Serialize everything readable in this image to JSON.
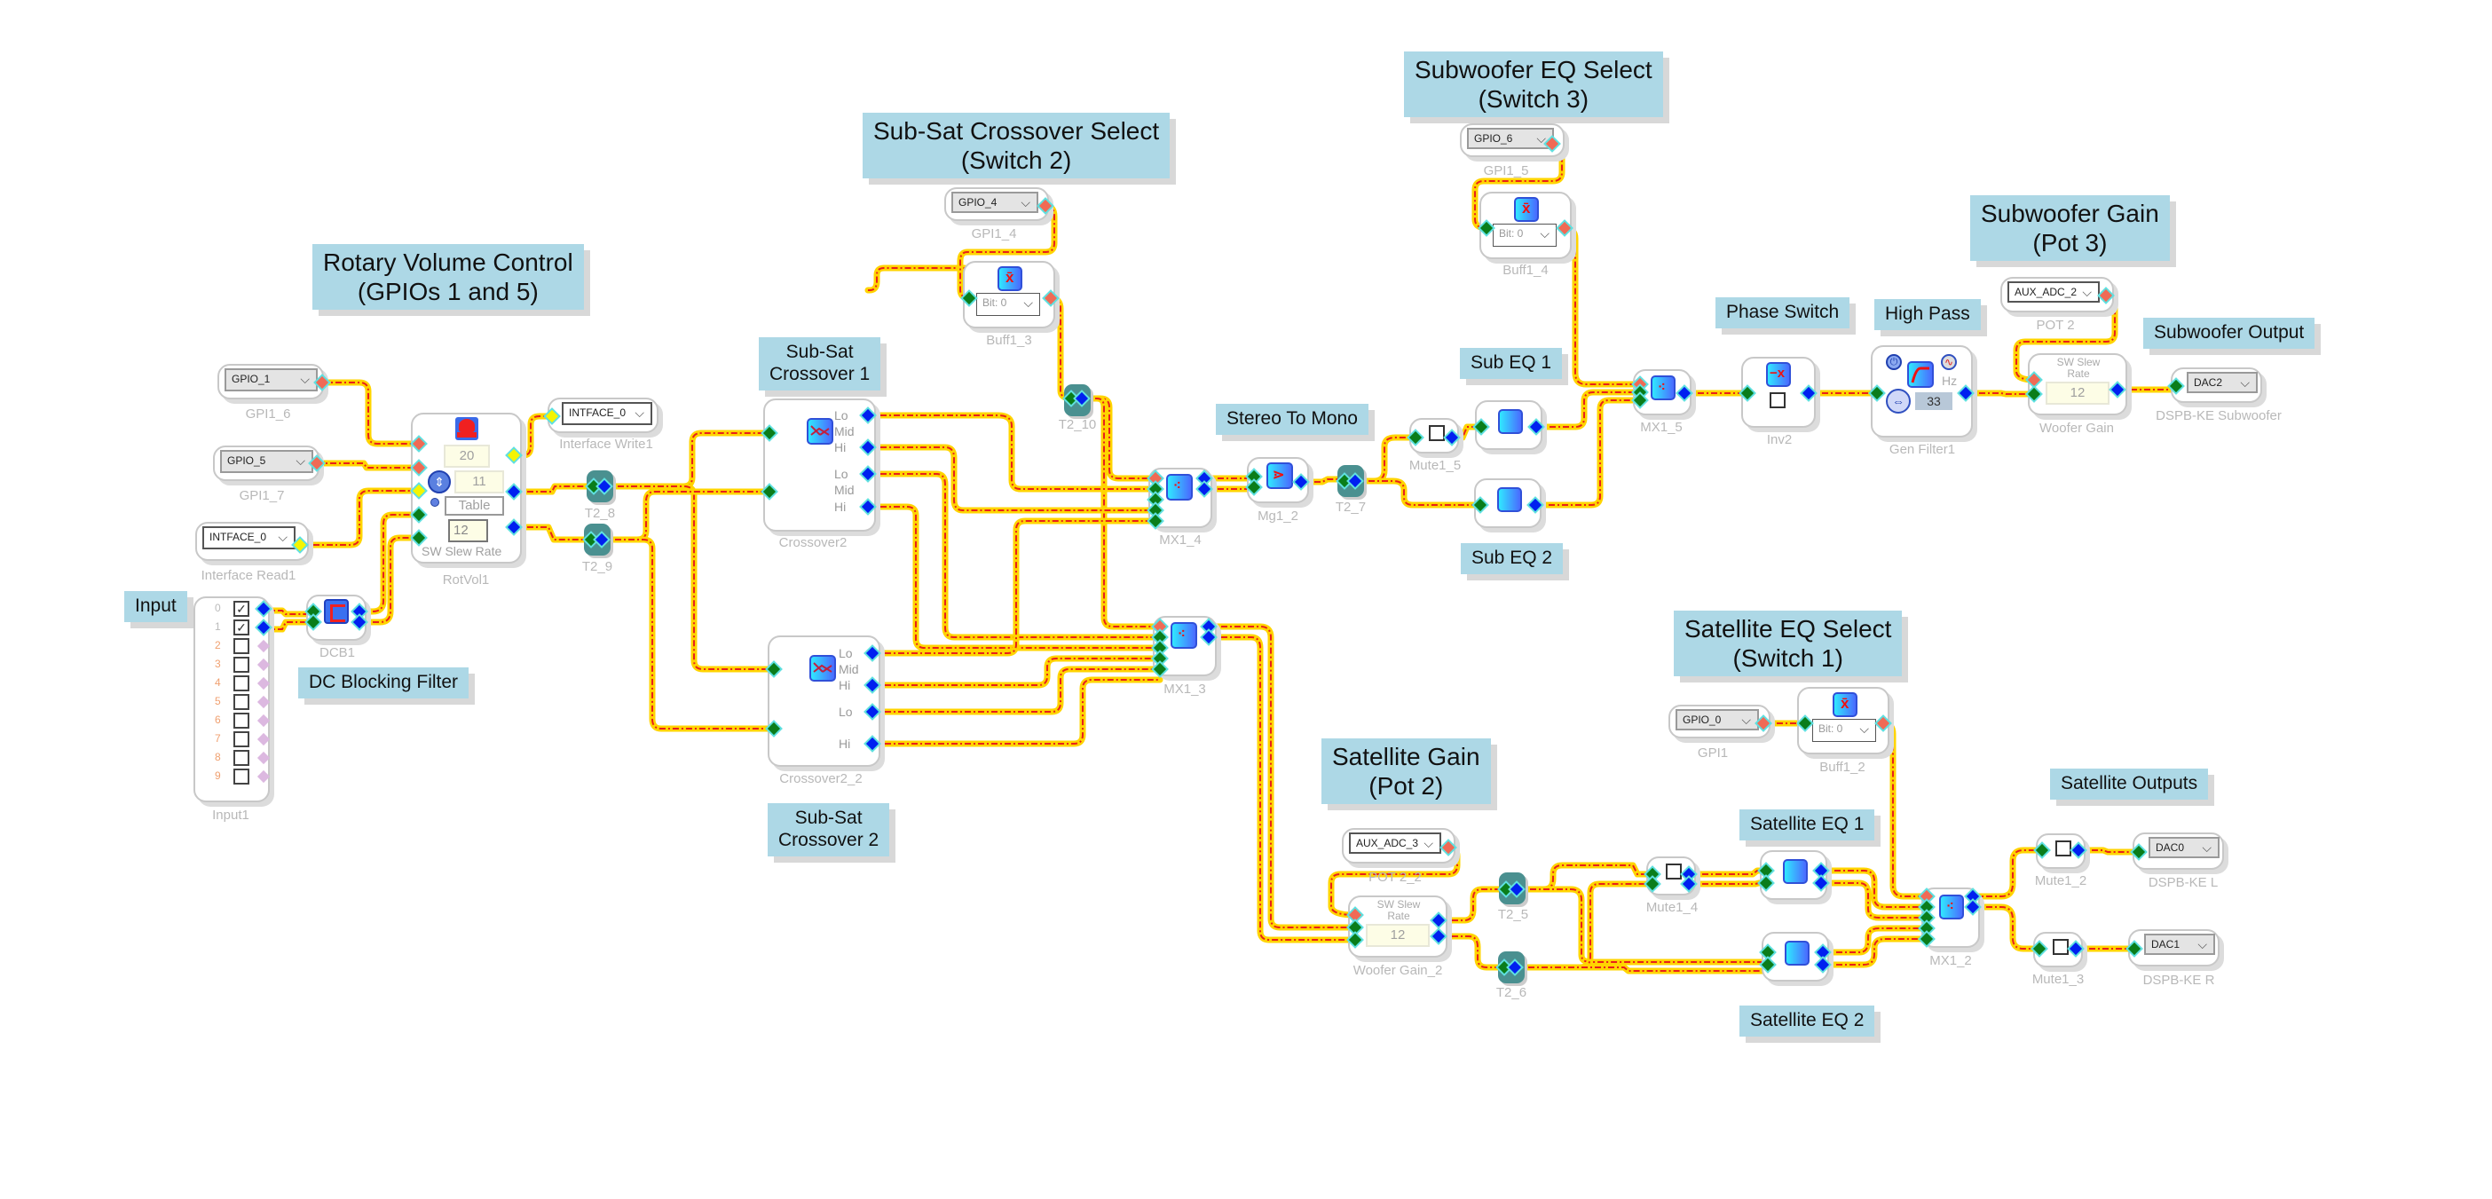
{
  "notes": {
    "rotary_volume": "Rotary Volume Control\n(GPIOs 1 and 5)",
    "input": "Input",
    "dc_blocking": "DC Blocking Filter",
    "subsat_crossover1": "Sub-Sat\nCrossover 1",
    "subsat_crossover2": "Sub-Sat\nCrossover 2",
    "subsat_select": "Sub-Sat Crossover Select\n(Switch 2)",
    "stereo_to_mono": "Stereo To Mono",
    "sub_eq1": "Sub EQ 1",
    "sub_eq2": "Sub EQ 2",
    "subwoofer_eq_select": "Subwoofer EQ Select\n(Switch 3)",
    "phase_switch": "Phase Switch",
    "high_pass": "High Pass",
    "subwoofer_gain": "Subwoofer Gain\n(Pot 3)",
    "subwoofer_output": "Subwoofer Output",
    "satellite_eq_select": "Satellite EQ Select\n(Switch 1)",
    "satellite_gain": "Satellite Gain\n(Pot 2)",
    "satellite_eq1": "Satellite EQ 1",
    "satellite_eq2": "Satellite EQ 2",
    "satellite_outputs": "Satellite Outputs"
  },
  "blocks": {
    "gpi1_6": {
      "label": "GPI1_6",
      "value": "GPIO_1"
    },
    "gpi1_7": {
      "label": "GPI1_7",
      "value": "GPIO_5"
    },
    "interface_read1": {
      "label": "Interface Read1",
      "value": "INTFACE_0"
    },
    "interface_write1": {
      "label": "Interface Write1",
      "value": "INTFACE_0"
    },
    "rotvol1": {
      "label": "RotVol1",
      "max": "20",
      "current": "11",
      "table": "Table",
      "slew": "12",
      "slew_label": "SW Slew Rate"
    },
    "input1": {
      "label": "Input1",
      "channels": [
        {
          "n": "0",
          "checked": true
        },
        {
          "n": "1",
          "checked": true
        },
        {
          "n": "2",
          "checked": false
        },
        {
          "n": "3",
          "checked": false
        },
        {
          "n": "4",
          "checked": false
        },
        {
          "n": "5",
          "checked": false
        },
        {
          "n": "6",
          "checked": false
        },
        {
          "n": "7",
          "checked": false
        },
        {
          "n": "8",
          "checked": false
        },
        {
          "n": "9",
          "checked": false
        }
      ]
    },
    "dcb1": {
      "label": "DCB1"
    },
    "t2_8": {
      "label": "T2_8"
    },
    "t2_9": {
      "label": "T2_9"
    },
    "t2_10": {
      "label": "T2_10"
    },
    "t2_7": {
      "label": "T2_7"
    },
    "t2_5": {
      "label": "T2_5"
    },
    "t2_6": {
      "label": "T2_6"
    },
    "crossover2": {
      "label": "Crossover2",
      "ports": [
        "Lo",
        "Mid",
        "Hi",
        "Lo",
        "Mid",
        "Hi"
      ]
    },
    "crossover2_2": {
      "label": "Crossover2_2",
      "ports": [
        "Lo",
        "Mid",
        "Hi",
        "Lo",
        "Hi"
      ]
    },
    "gpi1_4": {
      "label": "GPI1_4",
      "value": "GPIO_4"
    },
    "buff1_3": {
      "label": "Buff1_3",
      "bit": "Bit: 0"
    },
    "mx1_4": {
      "label": "MX1_4"
    },
    "mx1_3": {
      "label": "MX1_3"
    },
    "mg1_2": {
      "label": "Mg1_2"
    },
    "mute1_5": {
      "label": "Mute1_5"
    },
    "gpi1_5": {
      "label": "GPI1_5",
      "value": "GPIO_6"
    },
    "buff1_4": {
      "label": "Buff1_4",
      "bit": "Bit: 0"
    },
    "mx1_5": {
      "label": "MX1_5"
    },
    "inv2": {
      "label": "Inv2"
    },
    "gen_filter1": {
      "label": "Gen Filter1",
      "unit": "Hz",
      "freq": "33"
    },
    "pot2": {
      "label": "POT 2",
      "value": "AUX_ADC_2"
    },
    "woofer_gain": {
      "label": "Woofer Gain",
      "slew_label": "SW Slew\nRate",
      "slew": "12"
    },
    "dspb_sub": {
      "label": "DSPB-KE Subwoofer",
      "value": "DAC2"
    },
    "gpi1": {
      "label": "GPI1",
      "value": "GPIO_0"
    },
    "buff1_2": {
      "label": "Buff1_2",
      "bit": "Bit: 0"
    },
    "pot2_2": {
      "label": "POT 2_2",
      "value": "AUX_ADC_3"
    },
    "woofer_gain_2": {
      "label": "Woofer Gain_2",
      "slew_label": "SW Slew\nRate",
      "slew": "12"
    },
    "mute1_4": {
      "label": "Mute1_4"
    },
    "mx1_2": {
      "label": "MX1_2"
    },
    "mute1_2": {
      "label": "Mute1_2"
    },
    "mute1_3": {
      "label": "Mute1_3"
    },
    "dspb_l": {
      "label": "DSPB-KE L",
      "value": "DAC0"
    },
    "dspb_r": {
      "label": "DSPB-KE R",
      "value": "DAC1"
    }
  },
  "icons": {
    "chevron": "⌵",
    "check": "✓"
  },
  "colors": {
    "note_bg": "#add8e6",
    "wire": "#ffd400",
    "wire_core": "#e8201a"
  }
}
